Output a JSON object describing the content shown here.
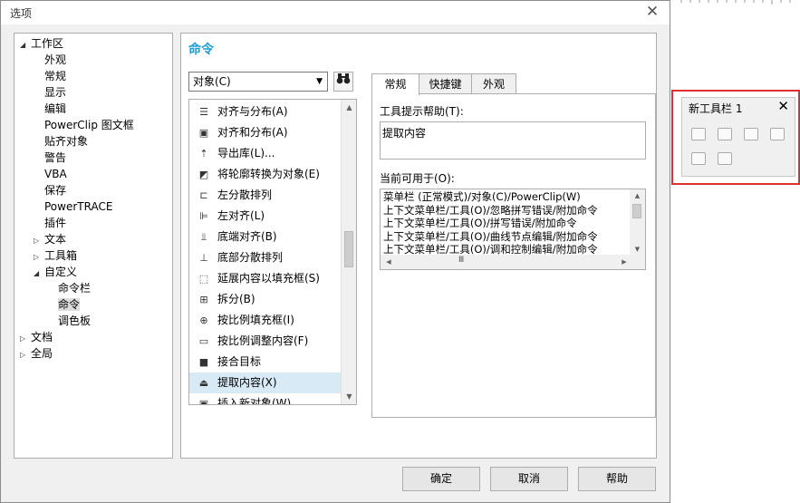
{
  "dialog": {
    "title": "选项",
    "close": "✕"
  },
  "tree": [
    {
      "arrow": "◢",
      "label": "工作区",
      "level": 0
    },
    {
      "arrow": "",
      "label": "外观",
      "level": 1
    },
    {
      "arrow": "",
      "label": "常规",
      "level": 1
    },
    {
      "arrow": "",
      "label": "显示",
      "level": 1
    },
    {
      "arrow": "",
      "label": "编辑",
      "level": 1
    },
    {
      "arrow": "",
      "label": "PowerClip 图文框",
      "level": 1
    },
    {
      "arrow": "",
      "label": "贴齐对象",
      "level": 1
    },
    {
      "arrow": "",
      "label": "警告",
      "level": 1
    },
    {
      "arrow": "",
      "label": "VBA",
      "level": 1
    },
    {
      "arrow": "",
      "label": "保存",
      "level": 1
    },
    {
      "arrow": "",
      "label": "PowerTRACE",
      "level": 1
    },
    {
      "arrow": "",
      "label": "插件",
      "level": 1
    },
    {
      "arrow": "▷",
      "label": "文本",
      "level": 1
    },
    {
      "arrow": "▷",
      "label": "工具箱",
      "level": 1
    },
    {
      "arrow": "◢",
      "label": "自定义",
      "level": 1
    },
    {
      "arrow": "",
      "label": "命令栏",
      "level": 2
    },
    {
      "arrow": "",
      "label": "命令",
      "level": 2,
      "selected": true
    },
    {
      "arrow": "",
      "label": "调色板",
      "level": 2
    },
    {
      "arrow": "▷",
      "label": "文档",
      "level": 0
    },
    {
      "arrow": "▷",
      "label": "全局",
      "level": 0
    }
  ],
  "main": {
    "title": "命令",
    "combo": "对象(C)",
    "find_icon": "binoculars-icon",
    "commands": [
      {
        "icon": "align-distribute-icon",
        "glyph": "☰",
        "label": "对齐与分布(A)"
      },
      {
        "icon": "align-distribute-add-icon",
        "glyph": "▣",
        "label": "对齐和分布(A)"
      },
      {
        "icon": "export-library-icon",
        "glyph": "⇡",
        "label": "导出库(L)..."
      },
      {
        "icon": "outline-to-object-icon",
        "glyph": "◩",
        "label": "将轮廓转换为对象(E)"
      },
      {
        "icon": "distribute-left-icon",
        "glyph": "⊏",
        "label": "左分散排列"
      },
      {
        "icon": "align-left-icon",
        "glyph": "⊫",
        "label": "左对齐(L)"
      },
      {
        "icon": "align-bottom-icon",
        "glyph": "⫫",
        "label": "底端对齐(B)"
      },
      {
        "icon": "distribute-bottom-icon",
        "glyph": "⊥",
        "label": "底部分散排列"
      },
      {
        "icon": "extend-fill-frame-icon",
        "glyph": "⬚",
        "label": "延展内容以填充框(S)"
      },
      {
        "icon": "split-icon",
        "glyph": "⊞",
        "label": "拆分(B)"
      },
      {
        "icon": "fill-frame-proportional-icon",
        "glyph": "⊕",
        "label": "按比例填充框(I)"
      },
      {
        "icon": "fit-content-proportional-icon",
        "glyph": "▭",
        "label": "按比例调整内容(F)"
      },
      {
        "icon": "join-target-icon",
        "glyph": "■",
        "label": "接合目标"
      },
      {
        "icon": "extract-content-icon",
        "glyph": "⏏",
        "label": "提取内容(X)",
        "selected": true
      },
      {
        "icon": "insert-new-object-icon",
        "glyph": "▣",
        "label": "插入新对象(W)..."
      }
    ],
    "tabs": [
      "常规",
      "快捷键",
      "外观"
    ],
    "tooltip_label": "工具提示帮助(T):",
    "tooltip_value": "提取内容",
    "available_label": "当前可用于(O):",
    "available": [
      "菜单栏 (正常模式)/对象(C)/PowerClip(W)",
      "上下文菜单栏/工具(O)/忽略拼写错误/附加命令",
      "上下文菜单栏/工具(O)/拼写错误/附加命令",
      "上下文菜单栏/工具(O)/曲线节点编辑/附加命令",
      "上下文菜单栏/工具(O)/调和控制编辑/附加命令"
    ]
  },
  "buttons": {
    "ok": "确定",
    "cancel": "取消",
    "help": "帮助"
  },
  "toolbar_window": {
    "title": "新工具栏 1",
    "close": "✕",
    "icons": [
      "toolbar-icon-1",
      "toolbar-icon-2",
      "toolbar-icon-3",
      "toolbar-icon-4",
      "toolbar-icon-5",
      "toolbar-icon-6"
    ]
  },
  "colors": {
    "accent": "#1a9dd9",
    "highlight_frame": "#e03030",
    "selection": "#d9eaf7"
  }
}
